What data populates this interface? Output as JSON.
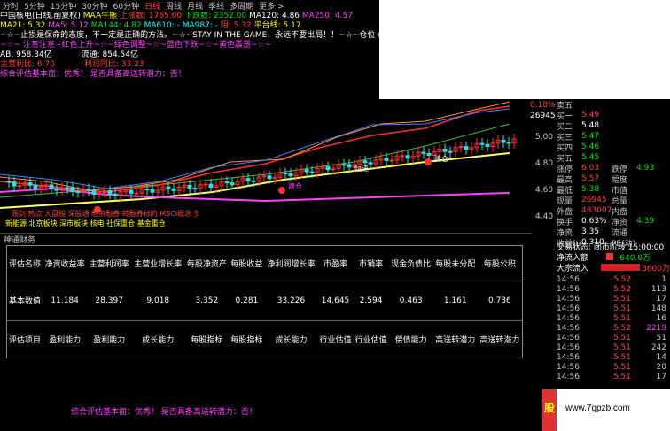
{
  "toolbar": {
    "items": [
      "分时",
      "5分钟",
      "15分钟",
      "30分钟",
      "60分钟",
      "日线",
      "周线",
      "月线",
      "季线",
      "多周期",
      "更多 >"
    ],
    "active": "日线"
  },
  "indicators": {
    "line1": {
      "title": "中国核电(日线,前复权)",
      "maa": "MAA牛熊",
      "up": "上涨数: 1765.00",
      "down": "下跌数: 2352.00",
      "ma120": "MA120: 4.86",
      "ma250": "MA250: 4.57"
    },
    "line2": {
      "ma21": "MA21: 5.32",
      "ma5": "MA5: 5.12",
      "ma144": "MA144: 4.82",
      "ma610": "MA610: -",
      "ma987": "MA987: -",
      "ji": "阻: 5.32",
      "bo": "平台线: 5.17"
    },
    "line3": "~☆~止损是保命的态度，不一定是正确的方法。~☆~STAY IN THE GAME，永远不要出局！！~☆~仓位+买点",
    "line4": "~☆~ 注意注意~红色上升~☆~绿色调整~☆~蓝色下跌~☆~黄色震荡~☆~",
    "line5": {
      "ab": "AB: 958.34亿",
      "flow": "流通: 854.54亿"
    },
    "line6": {
      "margin": "主营利比: 6.70",
      "profit": "利润同比: 33.23"
    },
    "line7": "综合评估基本面：优秀！ 是否具备高送转潜力：否！"
  },
  "chart": {
    "labels": [
      "短进",
      "建仓",
      "短进",
      "建仓",
      "财"
    ],
    "bottom_text": "轰剑 热点 大盘股 深股通 融资融券 转融券标的 MSCI概念 罗素大盘 沪股通",
    "bottom_text2": "新能源 北京板块 深市板块 核电 社保重仓 基金重仓"
  },
  "price_axis": [
    "5.00",
    "4.80",
    "4.60",
    "4.40"
  ],
  "pct_label": "0.18%",
  "vol_label": "26945",
  "quote": {
    "sells": [
      {
        "l": "卖五",
        "v": ""
      },
      {
        "l": "买一",
        "v": "5.49"
      },
      {
        "l": "买二",
        "v": "5.48"
      },
      {
        "l": "买三",
        "v": "5.47"
      },
      {
        "l": "买四",
        "v": "5.46"
      },
      {
        "l": "买五",
        "v": "5.45"
      }
    ],
    "stats": [
      {
        "l": "涨停",
        "v": "6.03",
        "l2": "跌停",
        "v2": "4.93"
      },
      {
        "l": "最高",
        "v": "5.57",
        "l2": "幅度",
        "v2": ""
      },
      {
        "l": "最低",
        "v": "5.38",
        "l2": "市值",
        "v2": ""
      },
      {
        "l": "现量",
        "v": "26945",
        "l2": "总量",
        "v2": ""
      },
      {
        "l": "外盘",
        "v": "483007",
        "l2": "内盘",
        "v2": ""
      }
    ],
    "extra": [
      {
        "l": "换手",
        "v": "0.63%",
        "l2": "净资",
        "v2": "4.39"
      },
      {
        "l": "净资",
        "v": "3.35",
        "l2": "流通",
        "v2": ""
      },
      {
        "l": "收益(t)",
        "v": "0.310",
        "l2": "PE(动)",
        "v2": ""
      }
    ]
  },
  "trade": {
    "state": "交易状态: 闭市阶段 15:00:00",
    "netin_label": "净流入额",
    "netin": "-640.0万",
    "big_label": "大宗流入",
    "big": "3600万"
  },
  "ticks": [
    [
      "14:56",
      "5.52",
      "1"
    ],
    [
      "14:56",
      "5.52",
      "113"
    ],
    [
      "14:56",
      "5.51",
      "17"
    ],
    [
      "14:56",
      "5.51",
      "148"
    ],
    [
      "14:56",
      "5.51",
      "16"
    ],
    [
      "14:56",
      "5.52",
      "2219"
    ],
    [
      "14:56",
      "5.51",
      "51"
    ],
    [
      "14:56",
      "5.51",
      "242"
    ],
    [
      "14:56",
      "5.51",
      "14"
    ],
    [
      "14:56",
      "5.51",
      "20"
    ],
    [
      "14:56",
      "5.51",
      "17"
    ]
  ],
  "panel_title": "神通财务",
  "table": {
    "headers": [
      "评估名称",
      "净资收益率",
      "主营利润率",
      "主营业增长率",
      "每股净资产",
      "每股收益",
      "净利润增长率",
      "市盈率",
      "市销率",
      "现金负债比",
      "每股未分配",
      "每股公积"
    ],
    "values": [
      "基本数值",
      "11.184",
      "28.397",
      "9.018",
      "3.352",
      "0.281",
      "33.226",
      "14.645",
      "2.594",
      "0.463",
      "1.161",
      "0.736"
    ],
    "evals": [
      "评估项目",
      "盈利能力",
      "盈利能力",
      "成长能力",
      "每股指标",
      "每股指标",
      "成长能力",
      "行业估值",
      "行业估值",
      "偿债能力",
      "高送转潜力",
      "高送转潜力"
    ]
  },
  "bottom_note": "综合评估基本面：优秀！ 是否具备高送转潜力：否！",
  "watermark": "www.7gpzb.com",
  "colors": {
    "bg": "#000000",
    "red": "#ff4040",
    "green": "#00e000",
    "yellow": "#ffff00",
    "magenta": "#ff40ff"
  }
}
